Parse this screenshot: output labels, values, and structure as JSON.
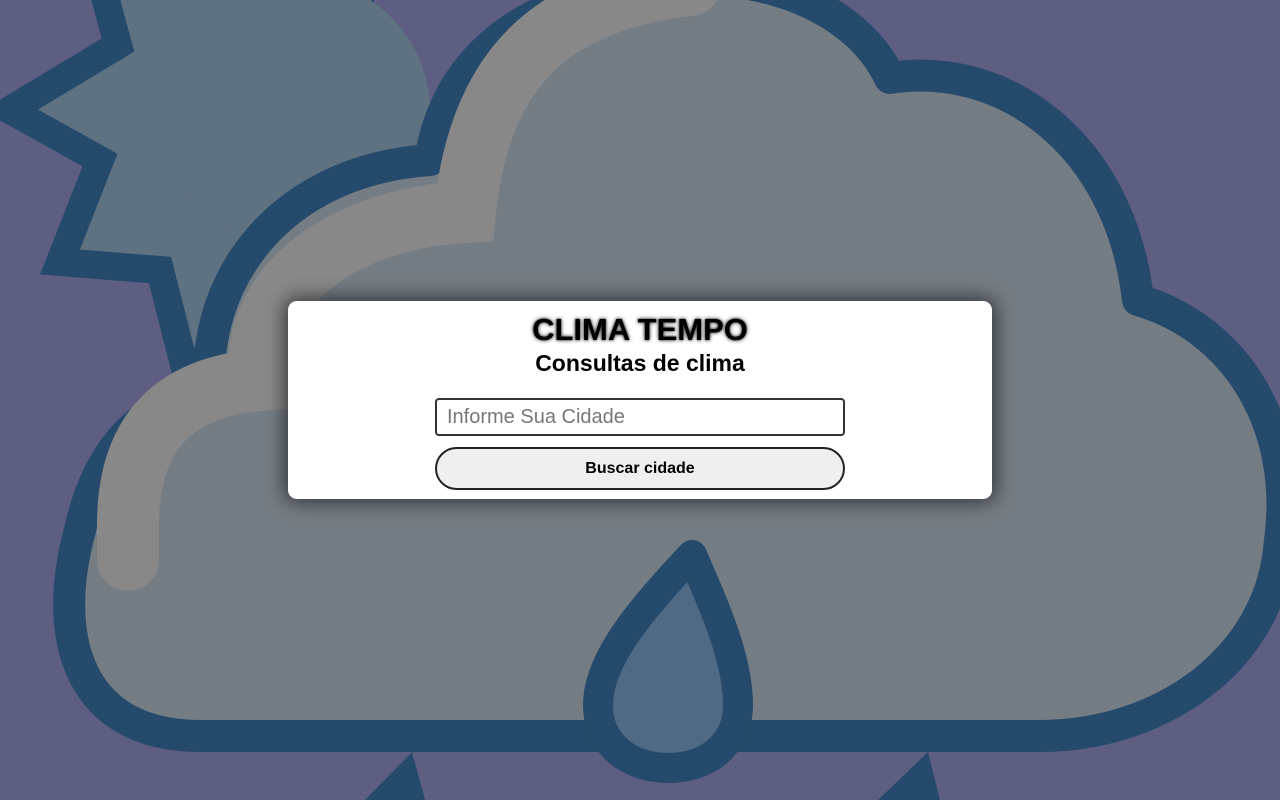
{
  "app": {
    "title": "CLIMA TEMPO",
    "subtitle": "Consultas de clima"
  },
  "search": {
    "placeholder": "Informe Sua Cidade",
    "value": "",
    "button_label": "Buscar cidade"
  },
  "background": {
    "icon": "partly-cloudy-rain-icon",
    "colors": {
      "page": "#5e5e82",
      "outline": "#254a6b",
      "sun": "#5f7282",
      "cloud": "#757d84",
      "cloud_highlight": "#888888",
      "drop": "#4e6a84"
    }
  }
}
